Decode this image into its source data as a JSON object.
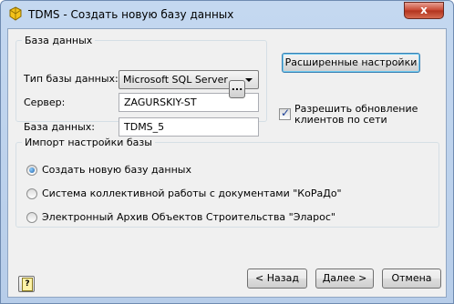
{
  "window": {
    "title": "TDMS - Создать новую базу данных",
    "close_label": "x"
  },
  "database_group": {
    "legend": "База данных",
    "db_type_label": "Тип базы данных:",
    "db_type_value": "Microsoft SQL Server",
    "server_label": "Сервер:",
    "server_value": "ZAGURSKIY-ST",
    "browse_label": "...",
    "db_name_label": "База данных:",
    "db_name_value": "TDMS_5"
  },
  "advanced_button_label": "Расширенные настройки",
  "network_update": {
    "label": "Разрешить обновление клиентов по сети",
    "checked": true
  },
  "import_group": {
    "legend": "Импорт настройки базы",
    "options": [
      {
        "label": "Создать новую базу данных",
        "selected": true
      },
      {
        "label": "Система коллективной работы с документами \"КоРаДо\"",
        "selected": false
      },
      {
        "label": "Электронный Архив Объектов Строительства \"Эларос\"",
        "selected": false
      }
    ]
  },
  "footer": {
    "back_label": "< Назад",
    "next_label": "Далее >",
    "cancel_label": "Отмена"
  },
  "icons": {
    "app": "tdms-app-icon",
    "help": "help-icon"
  }
}
